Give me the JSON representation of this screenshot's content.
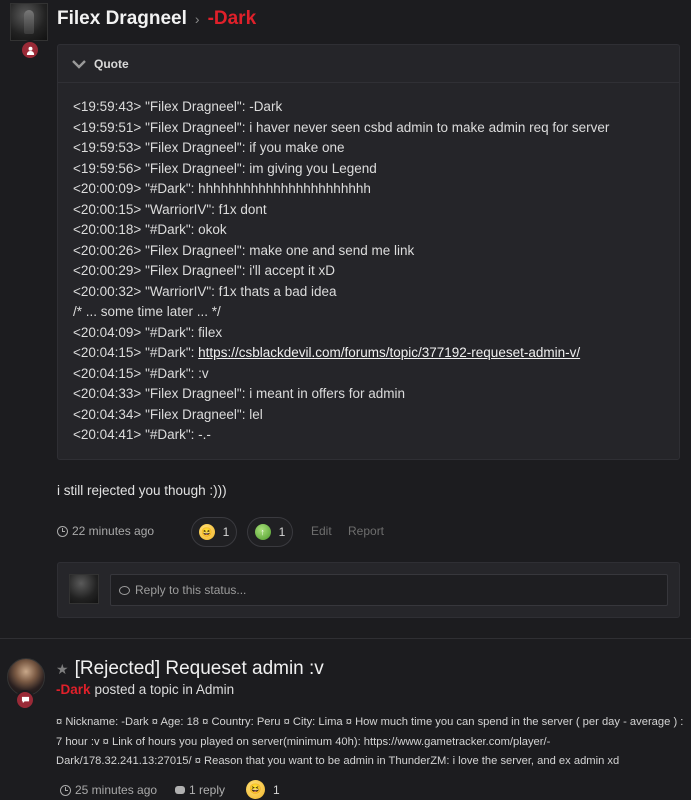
{
  "status_post": {
    "author": "Filex Dragneel",
    "target": "-Dark",
    "quote_title": "Quote",
    "quote_lines": [
      "<19:59:43> \"Filex Dragneel\": -Dark",
      "<19:59:51> \"Filex Dragneel\": i haver never seen csbd admin to make admin req for server",
      "<19:59:53> \"Filex Dragneel\": if you make one",
      "<19:59:56> \"Filex Dragneel\": im giving you Legend",
      "<20:00:09> \"#Dark\": hhhhhhhhhhhhhhhhhhhhhhh",
      "<20:00:15> \"WarriorIV\": f1x dont",
      "<20:00:18> \"#Dark\": okok",
      "<20:00:26> \"Filex Dragneel\": make one and send me link",
      "<20:00:29> \"Filex Dragneel\": i'll accept it xD",
      "<20:00:32> \"WarriorIV\": f1x thats a bad idea",
      "/* ... some time later ... */",
      "<20:04:09> \"#Dark\": filex",
      "<20:04:15> \"#Dark\": ",
      "<20:04:15> \"#Dark\": :v",
      "<20:04:33> \"Filex Dragneel\": i meant in offers for admin",
      "<20:04:34> \"Filex Dragneel\": lel",
      "<20:04:41> \"#Dark\": -.-"
    ],
    "quote_link": "https://csblackdevil.com/forums/topic/377192-requeset-admin-v/",
    "body": "i still rejected you though :)))",
    "time": "22 minutes ago",
    "reactions": [
      {
        "icon": "laugh-emoji",
        "count": "1"
      },
      {
        "icon": "thumbs-up-emoji",
        "count": "1"
      }
    ],
    "edit_label": "Edit",
    "report_label": "Report",
    "reply_placeholder": "Reply to this status..."
  },
  "topic_post": {
    "title": "[Rejected] Requeset admin :v",
    "author": "-Dark",
    "action": "posted a topic in Admin",
    "excerpt": "¤ Nickname: -Dark ¤ Age: 18 ¤ Country: Peru ¤ City: Lima ¤ How much time you can spend in the server ( per day - average ) : 7 hour :v ¤ Link of hours you played on server(minimum 40h): https://www.gametracker.com/player/-Dark/178.32.241.13:27015/ ¤ Reason that you want to be admin in ThunderZM: i love the server, and ex admin xd",
    "time": "25 minutes ago",
    "replies": "1 reply",
    "reaction": {
      "icon": "laugh-emoji",
      "count": "1"
    }
  },
  "colors": {
    "background": "#1c1c1f",
    "accent_red": "#e0202a",
    "badge": "#9a2a37"
  }
}
